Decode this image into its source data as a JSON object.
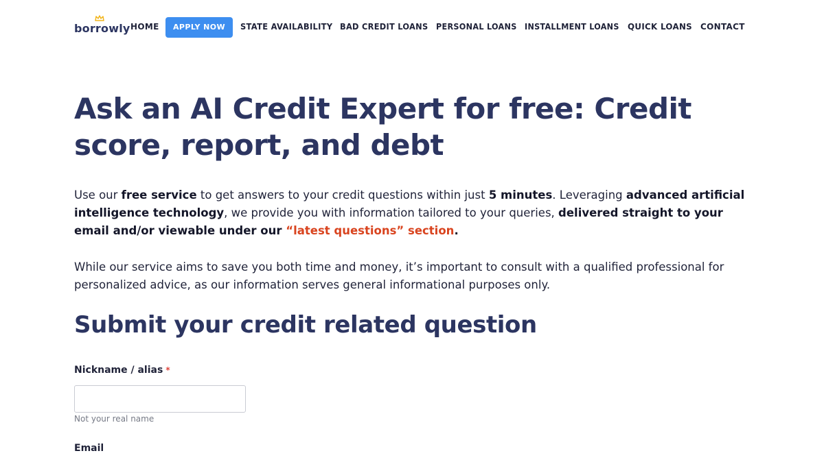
{
  "brand": {
    "logo_text": "borrowly"
  },
  "nav": {
    "home": "HOME",
    "apply": "APPLY NOW",
    "state": "STATE AVAILABILITY",
    "bad_credit": "BAD CREDIT LOANS",
    "personal": "PERSONAL LOANS",
    "installment": "INSTALLMENT LOANS",
    "quick": "QUICK LOANS",
    "contact": "CONTACT"
  },
  "hero": {
    "title": "Ask an AI Credit Expert for free: Credit score, report, and debt"
  },
  "intro": {
    "t1": "Use our ",
    "b1": "free service",
    "t2": " to get answers to your credit questions within just ",
    "b2": "5 minutes",
    "t3": ". Leveraging ",
    "b3": "advanced artificial intelligence technology",
    "t4": ", we provide you with information tailored to your queries, ",
    "b4": "delivered straight to your email and/or viewable under our ",
    "link": "“latest questions” section",
    "end": "."
  },
  "disclaimer": "While our service aims to save you both time and money, it’s important to consult with a qualified professional for personalized advice, as our information serves general informational purposes only.",
  "form": {
    "heading": "Submit your credit related question",
    "nickname_label": "Nickname / alias",
    "required_mark": "*",
    "nickname_value": "",
    "nickname_help": "Not your real name",
    "email_label": "Email"
  },
  "colors": {
    "heading": "#2c3561",
    "accent_button": "#3d8ef0",
    "link": "#d9441f",
    "crown": "#f2b51d"
  }
}
